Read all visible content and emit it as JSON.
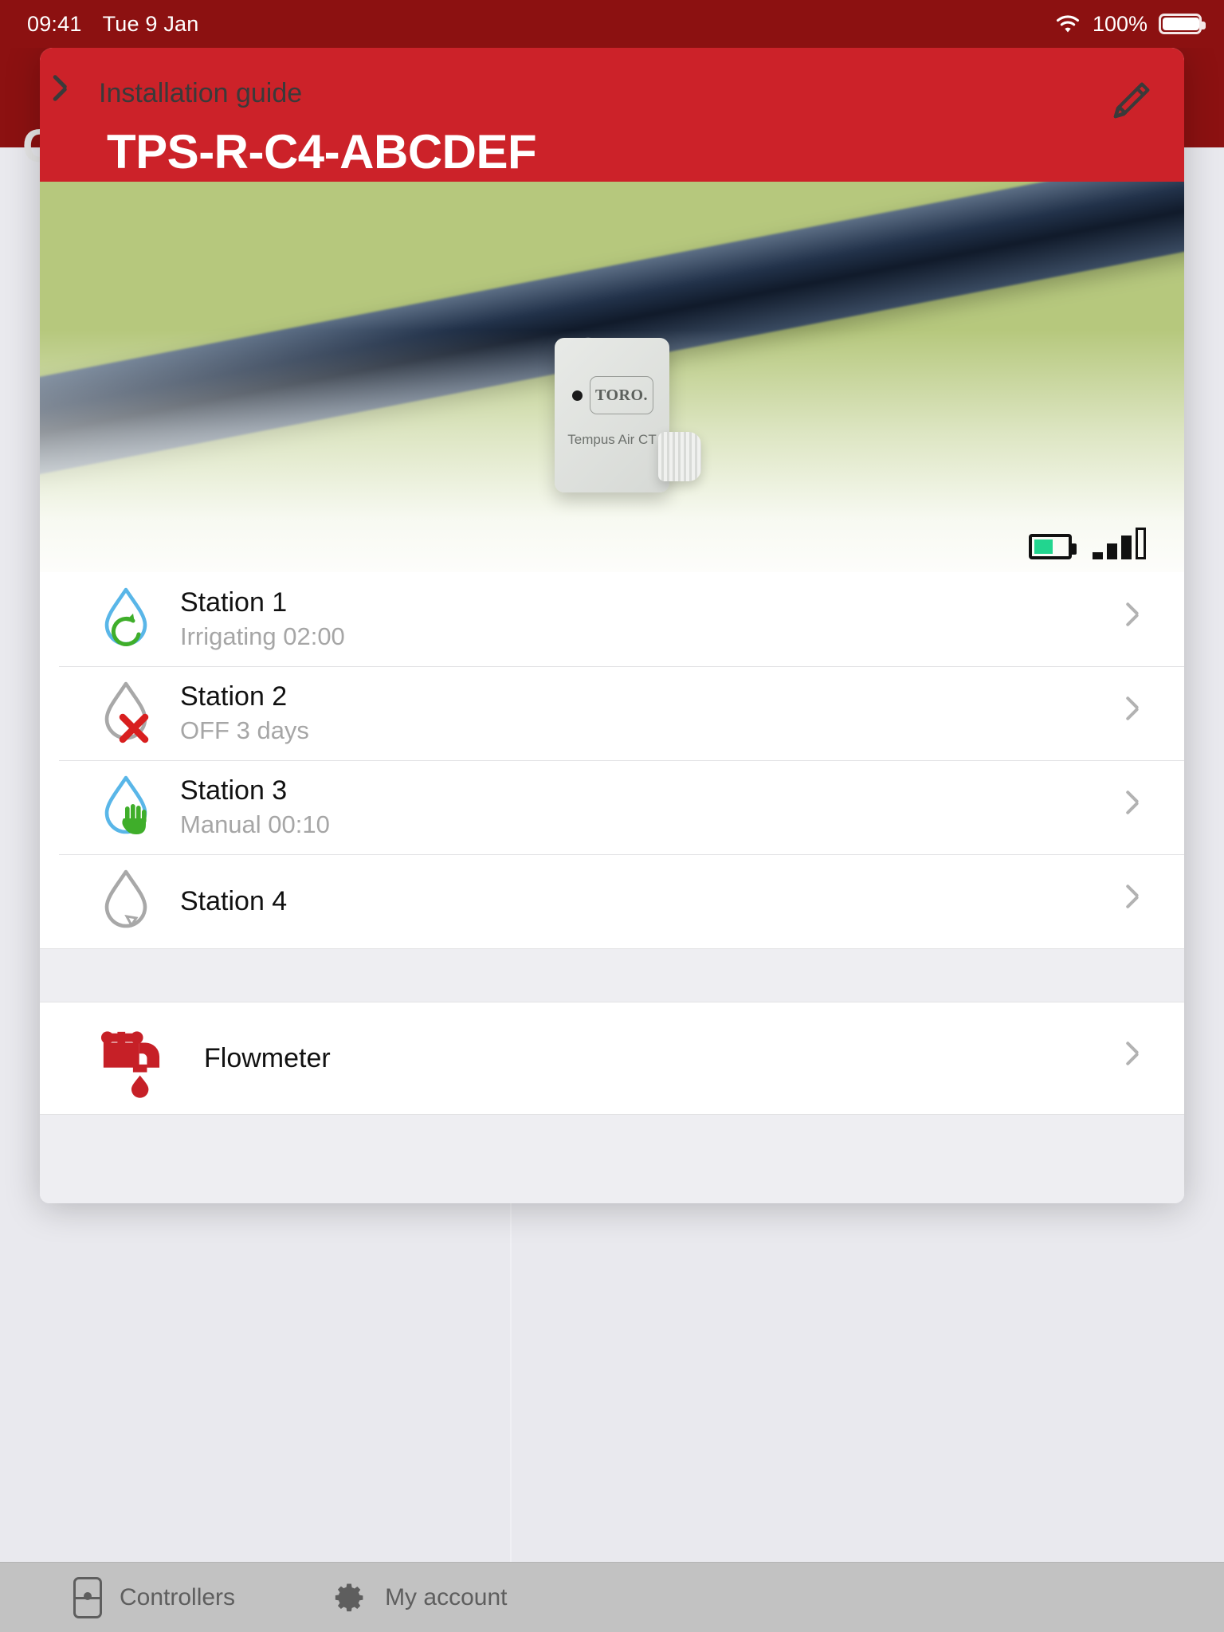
{
  "status_bar": {
    "time": "09:41",
    "date": "Tue 9 Jan",
    "battery_percent": "100%",
    "wifi_icon": "wifi-icon",
    "battery_icon": "battery-full-icon"
  },
  "background_app": {
    "title": "C",
    "tabbar": {
      "items": [
        {
          "label": "Controllers",
          "icon": "controller-icon"
        },
        {
          "label": "My account",
          "icon": "gear-icon"
        }
      ]
    }
  },
  "modal": {
    "header": {
      "back_label": "Installation guide",
      "back_icon": "chevron-left-icon",
      "edit_icon": "pencil-icon",
      "device_id": "TPS-R-C4-ABCDEF",
      "background_color": "#cc2229"
    },
    "hero": {
      "device_logo": "TORO.",
      "device_model": "Tempus Air CT",
      "battery_icon": "battery-half-icon",
      "battery_level_percent": 55,
      "signal_icon": "signal-bars-icon",
      "signal_bars_filled": 3,
      "signal_bars_total": 4
    },
    "stations": [
      {
        "name": "Station 1",
        "status": "Irrigating 02:00",
        "icon": "water-drop-irrigating-icon",
        "drop_color": "#59b6e8",
        "badge_color": "#3fae2a",
        "chevron_icon": "chevron-right-icon"
      },
      {
        "name": "Station 2",
        "status": "OFF 3 days",
        "icon": "water-drop-off-icon",
        "drop_color": "#a8a8a8",
        "badge_color": "#d81f1f",
        "chevron_icon": "chevron-right-icon"
      },
      {
        "name": "Station 3",
        "status": "Manual 00:10",
        "icon": "water-drop-manual-icon",
        "drop_color": "#59b6e8",
        "badge_color": "#3fae2a",
        "chevron_icon": "chevron-right-icon"
      },
      {
        "name": "Station 4",
        "status": "",
        "icon": "water-drop-idle-icon",
        "drop_color": "#a8a8a8",
        "badge_color": "#a8a8a8",
        "chevron_icon": "chevron-right-icon"
      }
    ],
    "flowmeter": {
      "label": "Flowmeter",
      "icon": "faucet-icon",
      "icon_color": "#c62027",
      "chevron_icon": "chevron-right-icon"
    }
  }
}
